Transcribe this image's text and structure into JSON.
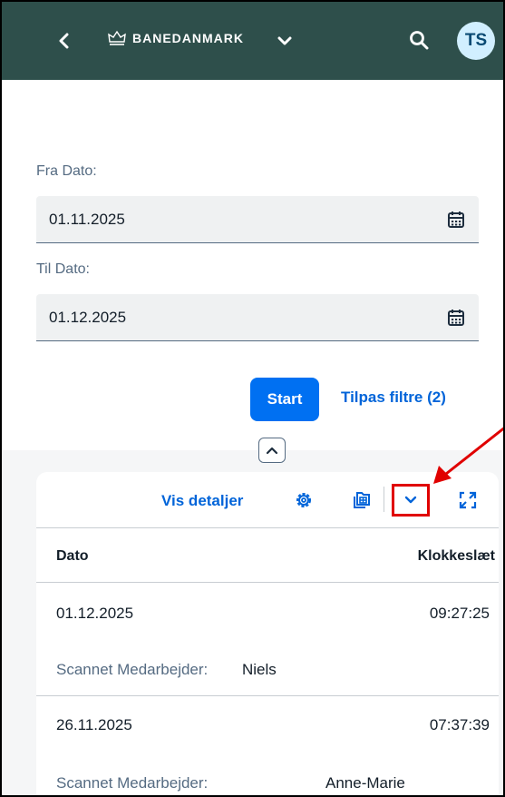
{
  "header": {
    "logo_text": "BANEDANMARK",
    "avatar_initials": "TS",
    "colors": {
      "background": "#2e4f4b",
      "avatar_bg": "#d1efff"
    }
  },
  "filters": {
    "fra_label": "Fra Dato:",
    "fra_value": "01.11.2025",
    "til_label": "Til Dato:",
    "til_value": "01.12.2025",
    "start_label": "Start",
    "tilpas_label": "Tilpas filtre (2)"
  },
  "toolbar": {
    "vis_detaljer": "Vis detaljer",
    "icons": [
      "settings-icon",
      "export-icon",
      "chevron-down-icon",
      "fullscreen-icon"
    ]
  },
  "table": {
    "columns": {
      "dato": "Dato",
      "klokkeslaet": "Klokkeslæt"
    },
    "rows": [
      {
        "date": "01.12.2025",
        "time": "09:27:25",
        "label": "Scannet Medarbejder:",
        "value": "Niels"
      },
      {
        "date": "26.11.2025",
        "time": "07:37:39",
        "label": "Scannet Medarbejder:",
        "value": "Anne-Marie"
      }
    ]
  },
  "colors": {
    "accent": "#0070f2",
    "link": "#0064d9",
    "highlight": "#e00000"
  }
}
